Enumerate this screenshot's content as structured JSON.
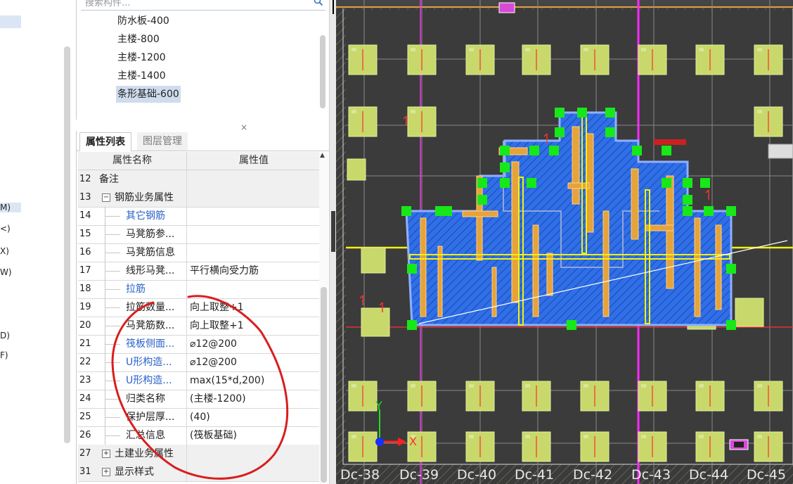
{
  "left_strip": {
    "fragments": [
      "M)",
      "<)",
      "X)",
      "W)",
      "D)",
      "F)"
    ]
  },
  "component_list": {
    "search_placeholder": "搜索构件...",
    "items": [
      {
        "label": "防水板-400",
        "selected": false
      },
      {
        "label": "主楼-800",
        "selected": false
      },
      {
        "label": "主楼-1200",
        "selected": false
      },
      {
        "label": "主楼-1400",
        "selected": false
      },
      {
        "label": "条形基础-600",
        "selected": true
      }
    ],
    "close_glyph": "×"
  },
  "property_panel": {
    "tabs": [
      "属性列表",
      "图层管理"
    ],
    "active_tab": "属性列表",
    "headers": {
      "name": "属性名称",
      "value": "属性值"
    },
    "rows": [
      {
        "num": "12",
        "name": "备注",
        "value": "",
        "blue": false,
        "indent": 0
      },
      {
        "num": "13",
        "name": "钢筋业务属性",
        "value": "",
        "blue": false,
        "indent": 0,
        "toggle": "−"
      },
      {
        "num": "14",
        "name": "其它钢筋",
        "value": "",
        "blue": true,
        "indent": 1
      },
      {
        "num": "15",
        "name": "马凳筋参...",
        "value": "",
        "blue": false,
        "indent": 1
      },
      {
        "num": "16",
        "name": "马凳筋信息",
        "value": "",
        "blue": false,
        "indent": 1
      },
      {
        "num": "17",
        "name": "线形马凳...",
        "value": "平行横向受力筋",
        "blue": false,
        "indent": 1
      },
      {
        "num": "18",
        "name": "拉筋",
        "value": "",
        "blue": true,
        "indent": 1
      },
      {
        "num": "19",
        "name": "拉筋数量...",
        "value": "向上取整+1",
        "blue": false,
        "indent": 1
      },
      {
        "num": "20",
        "name": "马凳筋数...",
        "value": "向上取整+1",
        "blue": false,
        "indent": 1
      },
      {
        "num": "21",
        "name": "筏板侧面...",
        "value": "⌀12@200",
        "blue": true,
        "indent": 1
      },
      {
        "num": "22",
        "name": "U形构造...",
        "value": "⌀12@200",
        "blue": true,
        "indent": 1
      },
      {
        "num": "23",
        "name": "U形构造...",
        "value": "max(15*d,200)",
        "blue": true,
        "indent": 1
      },
      {
        "num": "24",
        "name": "归类名称",
        "value": "(主楼-1200)",
        "blue": false,
        "indent": 1
      },
      {
        "num": "25",
        "name": "保护层厚...",
        "value": "(40)",
        "blue": false,
        "indent": 1
      },
      {
        "num": "26",
        "name": "汇总信息",
        "value": "(筏板基础)",
        "blue": false,
        "indent": 1
      },
      {
        "num": "27",
        "name": "土建业务属性",
        "value": "",
        "blue": false,
        "indent": 0,
        "toggle": "+"
      },
      {
        "num": "31",
        "name": "显示样式",
        "value": "",
        "blue": false,
        "indent": 0,
        "toggle": "+"
      }
    ]
  },
  "cad": {
    "axis_labels": [
      "Dc-38",
      "Dc-39",
      "Dc-40",
      "Dc-41",
      "Dc-42",
      "Dc-43",
      "Dc-44",
      "Dc-45"
    ],
    "ucs": {
      "x": "X",
      "y": "Y"
    },
    "colors": {
      "background": "#3b3b3b",
      "slab": "#2f6fe8",
      "pile_cap": "#c8d86a",
      "node": "#17e817",
      "grid_line": "#ff28ff",
      "beam": "#f2f20c",
      "rebar": "#e6a33a",
      "annotation": "#ff3030"
    }
  }
}
